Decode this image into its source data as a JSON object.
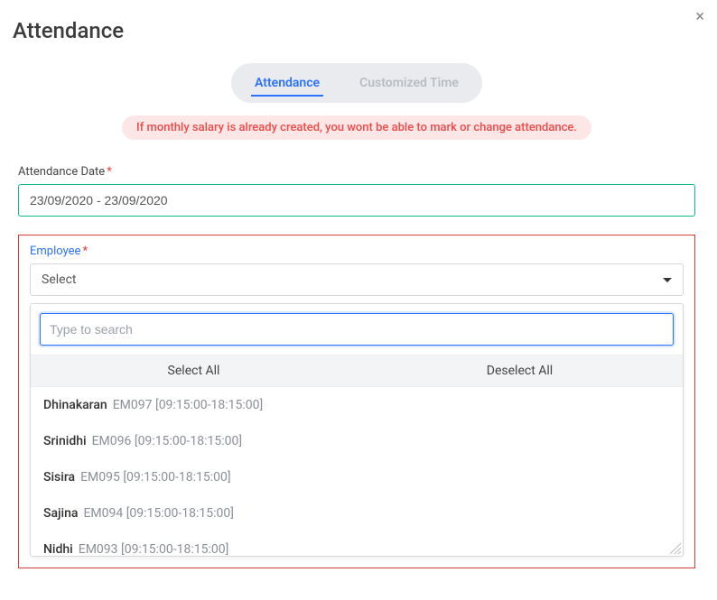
{
  "header": {
    "title": "Attendance"
  },
  "tabs": {
    "attendance": "Attendance",
    "customized": "Customized Time"
  },
  "warning": "If monthly salary is already created, you wont be able to mark or change attendance.",
  "date_field": {
    "label": "Attendance Date",
    "value": "23/09/2020 - 23/09/2020"
  },
  "employee_field": {
    "label": "Employee",
    "selected_label": "Select",
    "search_placeholder": "Type to search",
    "select_all": "Select All",
    "deselect_all": "Deselect All",
    "options": [
      {
        "name": "Dhinakaran",
        "meta": "EM097 [09:15:00-18:15:00]"
      },
      {
        "name": "Srinidhi",
        "meta": "EM096 [09:15:00-18:15:00]"
      },
      {
        "name": "Sisira",
        "meta": "EM095 [09:15:00-18:15:00]"
      },
      {
        "name": "Sajina",
        "meta": "EM094 [09:15:00-18:15:00]"
      },
      {
        "name": "Nidhi",
        "meta": "EM093 [09:15:00-18:15:00]"
      }
    ]
  }
}
